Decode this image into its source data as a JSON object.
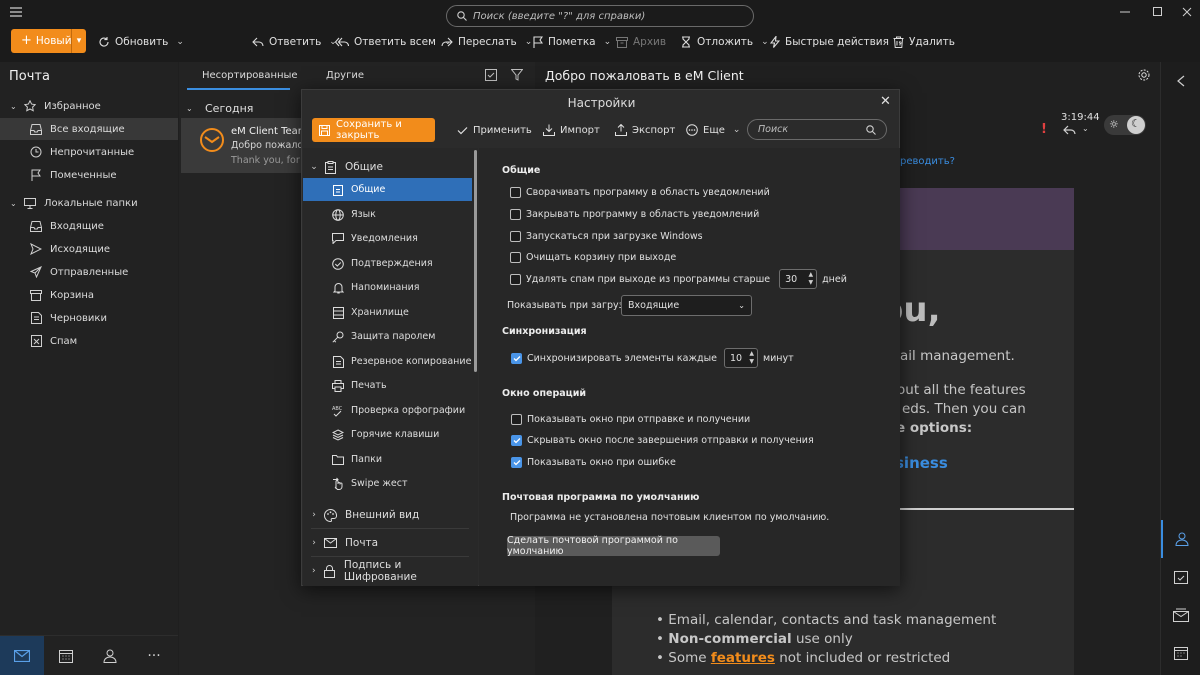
{
  "titlebar": {
    "search_placeholder": "Поиск (введите \"?\" для справки)"
  },
  "toolbar": {
    "new_label": "Новый",
    "refresh_label": "Обновить",
    "reply_label": "Ответить",
    "reply_all_label": "Ответить всем",
    "forward_label": "Переслать",
    "flag_label": "Пометка",
    "archive_label": "Архив",
    "snooze_label": "Отложить",
    "quick_actions_label": "Быстрые действия",
    "delete_label": "Удалить"
  },
  "leftnav": {
    "title": "Почта",
    "favorites_label": "Избранное",
    "favorites": [
      "Все входящие",
      "Непрочитанные",
      "Помеченные"
    ],
    "local_label": "Локальные папки",
    "local": [
      "Входящие",
      "Исходящие",
      "Отправленные",
      "Корзина",
      "Черновики",
      "Спам"
    ]
  },
  "msglist": {
    "tab_unsorted": "Несортированные",
    "tab_other": "Другие",
    "group_today": "Сегодня",
    "item": {
      "sender": "eM Client Team",
      "subject": "Добро пожалова",
      "preview": "Thank you, for ch"
    }
  },
  "reading": {
    "title": "Добро пожаловать в eM Client",
    "time": "3:19:44",
    "link_fragment": "реводить?",
    "hero_fragment": "ou,",
    "lines": [
      "ail management.",
      "out all the features",
      "eds. Then you can",
      "e options:",
      "siness"
    ],
    "bullets": [
      "Email, calendar, contacts and task management",
      "Non-commercial",
      " use only",
      "Some ",
      "features",
      " not included or restricted"
    ]
  },
  "dialog": {
    "title": "Настройки",
    "save_close": "Сохранить и закрыть",
    "apply": "Применить",
    "import": "Импорт",
    "export": "Экспорт",
    "more": "Еще",
    "search_placeholder": "Поиск",
    "tree": {
      "general_group": "Общие",
      "items": [
        "Общие",
        "Язык",
        "Уведомления",
        "Подтверждения",
        "Напоминания",
        "Хранилище",
        "Защита паролем",
        "Резервное копирование",
        "Печать",
        "Проверка орфографии",
        "Горячие клавиши",
        "Папки",
        "Swipe жест"
      ],
      "groups": [
        "Внешний вид",
        "Почта",
        "Подпись и Шифрование"
      ]
    },
    "content": {
      "section_general": "Общие",
      "opt_minimize": "Сворачивать программу в область уведомлений",
      "opt_close": "Закрывать программу в область уведомлений",
      "opt_startup": "Запускаться при загрузке Windows",
      "opt_empty_trash": "Очищать корзину при выходе",
      "opt_delete_spam": "Удалять спам при выходе из программы старше",
      "spam_days": "30",
      "days_label": "дней",
      "show_on_load_label": "Показывать при загрузке:",
      "show_on_load_value": "Входящие",
      "section_sync": "Синхронизация",
      "opt_sync": "Синхронизировать элементы каждые",
      "sync_minutes": "10",
      "minutes_label": "минут",
      "section_ops": "Окно операций",
      "opt_show_send": "Показывать окно при отправке и получении",
      "opt_hide_after": "Скрывать окно после завершения отправки и получения",
      "opt_show_error": "Показывать окно при ошибке",
      "section_default": "Почтовая программа по умолчанию",
      "default_status": "Программа не установлена почтовым клиентом по умолчанию.",
      "default_button": "Сделать почтовой программой по умолчанию"
    }
  },
  "colors": {
    "accent_orange": "#f28c1b",
    "selection_blue": "#2f6fb8",
    "checkbox_blue": "#4a95e8",
    "link_blue": "#3a8de0"
  }
}
